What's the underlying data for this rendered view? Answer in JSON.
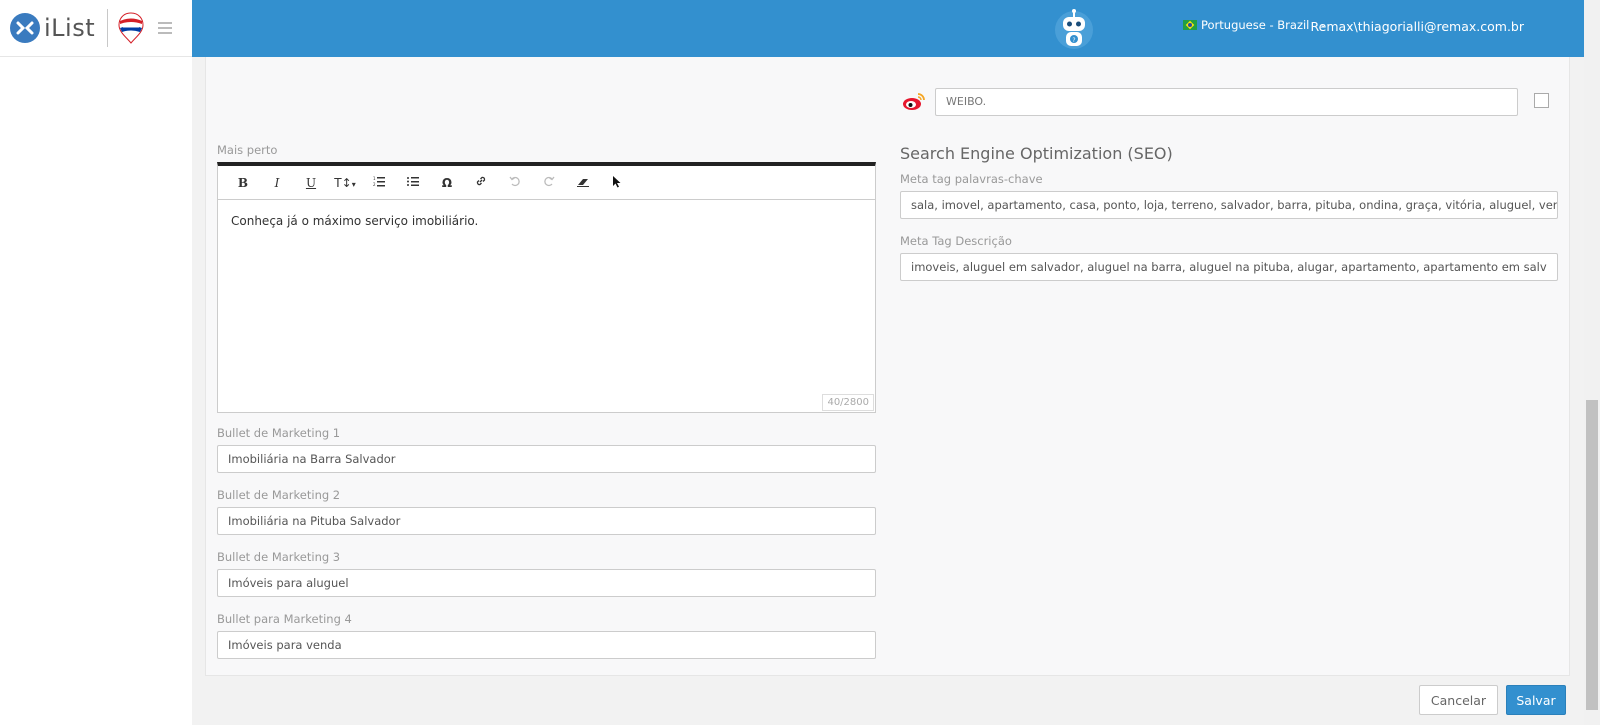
{
  "app": {
    "logo_text": "iList"
  },
  "header": {
    "language": "Portuguese - Brazil",
    "user": "Remax\\thiagorialli@remax.com.br"
  },
  "form": {
    "mais_perto_label": "Mais perto",
    "editor_content": "Conheça já o máximo serviço imobiliário.",
    "editor_counter": "40/2800",
    "bullet1_label": "Bullet de Marketing 1",
    "bullet1_value": "Imobiliária na Barra Salvador",
    "bullet2_label": "Bullet de Marketing 2",
    "bullet2_value": "Imobiliária na Pituba Salvador",
    "bullet3_label": "Bullet de Marketing 3",
    "bullet3_value": "Imóveis para aluguel",
    "bullet4_label": "Bullet para Marketing 4",
    "bullet4_value": "Imóveis para venda",
    "weibo_value": "WEIBO.",
    "seo_title": "Search Engine Optimization (SEO)",
    "meta_keywords_label": "Meta tag palavras-chave",
    "meta_keywords_value": "sala, imovel, apartamento, casa, ponto, loja, terreno, salvador, barra, pituba, ondina, graça, vitória, aluguel, ver",
    "meta_desc_label": "Meta Tag Descrição",
    "meta_desc_value": "imoveis, aluguel em salvador, aluguel na barra, aluguel na pituba, alugar, apartamento, apartamento em salv"
  },
  "toolbar": {
    "bold": "B",
    "italic": "I",
    "underline": "U",
    "fontsize": "T↕",
    "special_char": "Ω"
  },
  "actions": {
    "cancel": "Cancelar",
    "save": "Salvar"
  },
  "colors": {
    "primary": "#3390cf"
  }
}
